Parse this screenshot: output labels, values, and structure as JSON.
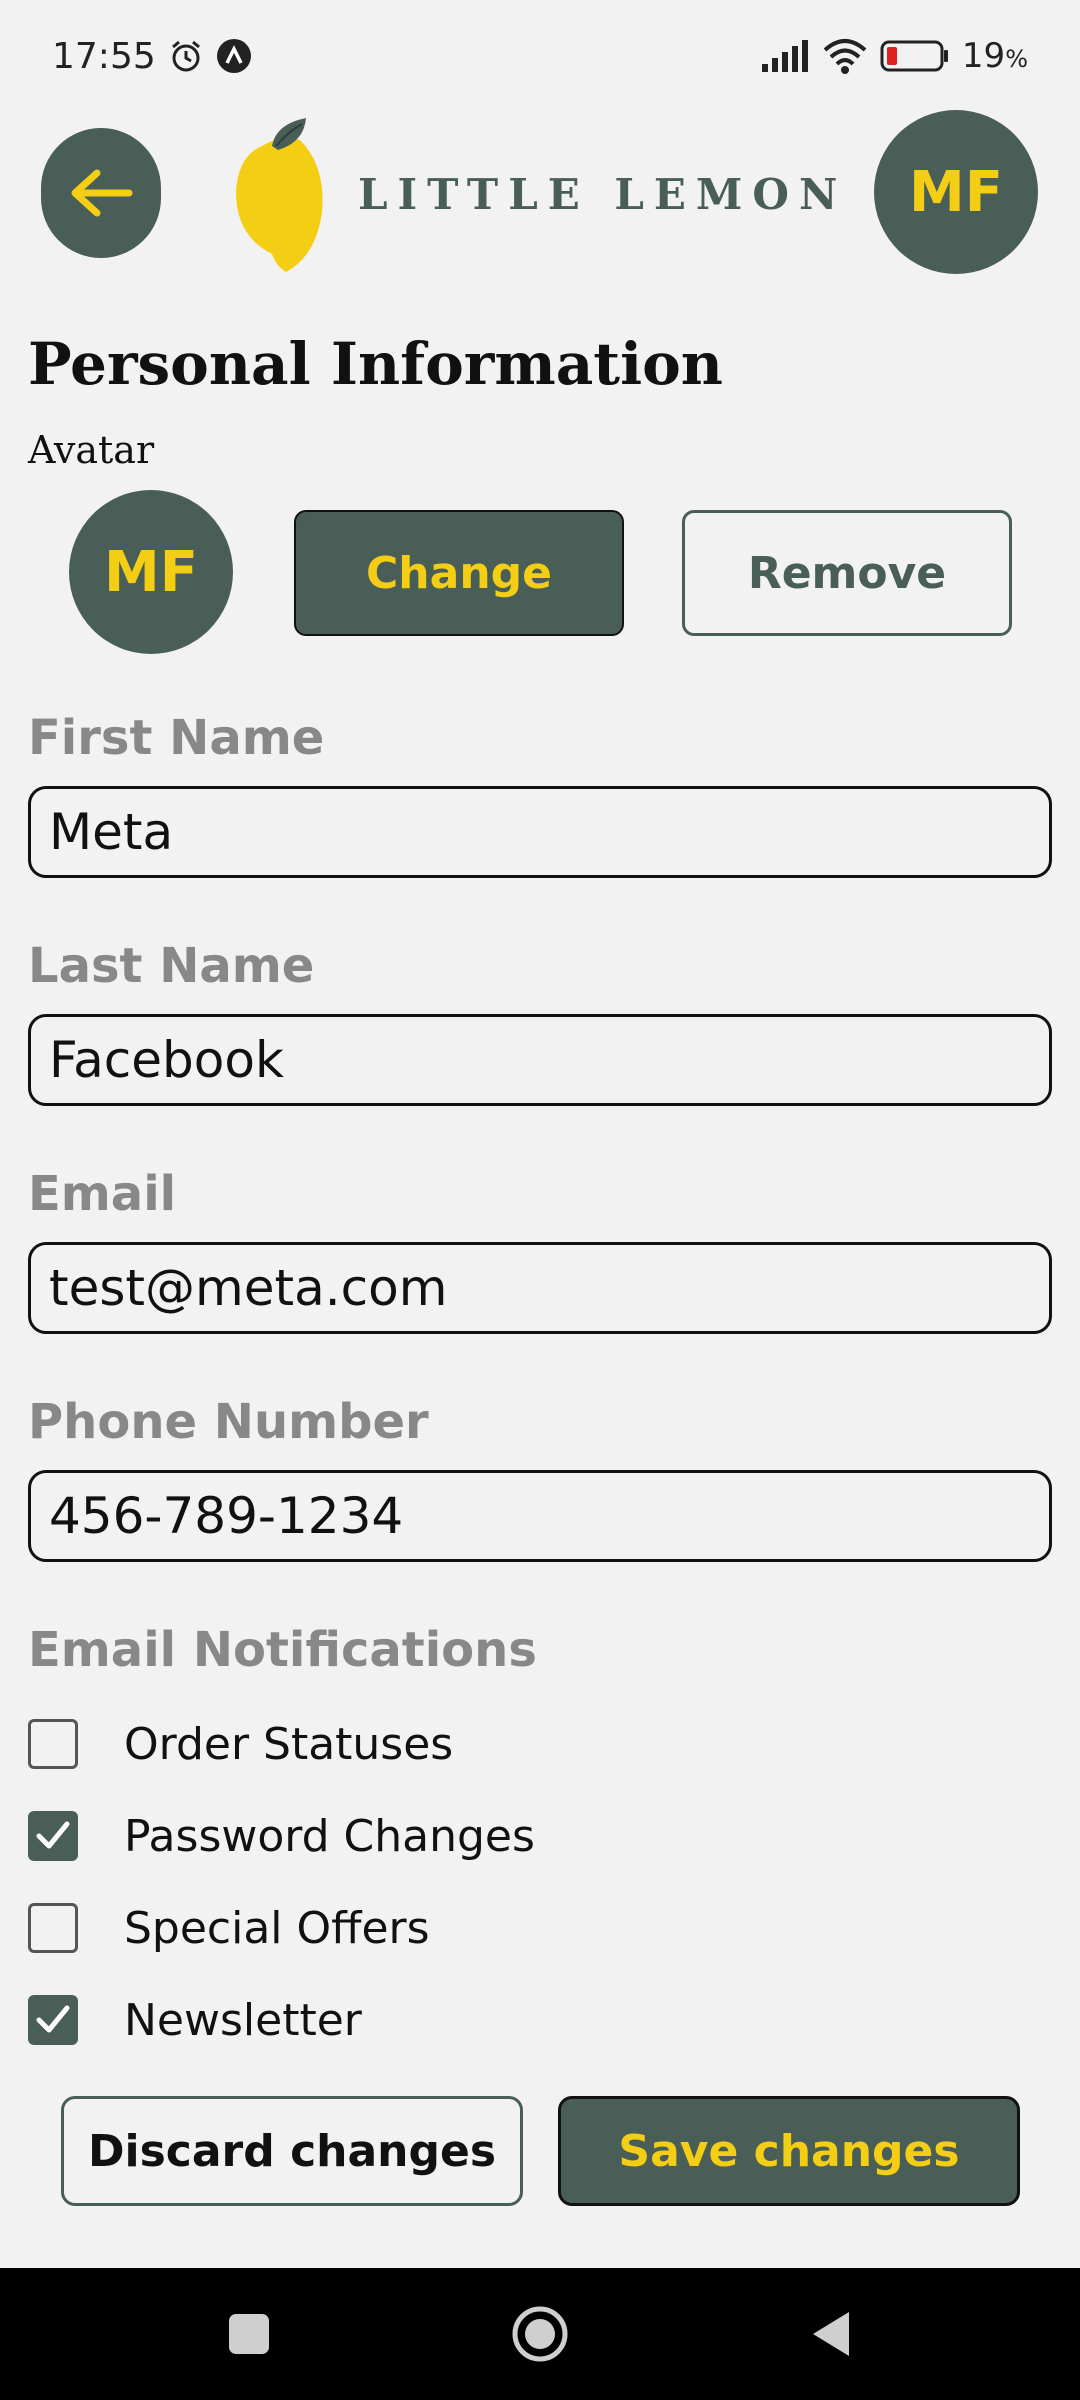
{
  "status_bar": {
    "time": "17:55",
    "battery_percent": "19",
    "battery_suffix": "%",
    "icons": [
      "alarm-icon",
      "app-notification-icon",
      "signal-icon",
      "wifi-icon",
      "battery-icon"
    ]
  },
  "header": {
    "back_icon": "arrow-left-icon",
    "logo_text": "LITTLE LEMON",
    "avatar_initials": "MF"
  },
  "colors": {
    "primary": "#495e57",
    "accent": "#f4ce14",
    "background": "#f2f2f2"
  },
  "page": {
    "title": "Personal Information",
    "avatar_label": "Avatar",
    "avatar_initials": "MF",
    "change_label": "Change",
    "remove_label": "Remove"
  },
  "form": {
    "first_name": {
      "label": "First Name",
      "value": "Meta"
    },
    "last_name": {
      "label": "Last Name",
      "value": "Facebook"
    },
    "email": {
      "label": "Email",
      "value": "test@meta.com"
    },
    "phone": {
      "label": "Phone Number",
      "value": "456-789-1234"
    }
  },
  "notifications": {
    "title": "Email Notifications",
    "items": [
      {
        "label": "Order Statuses",
        "checked": false
      },
      {
        "label": "Password Changes",
        "checked": true
      },
      {
        "label": "Special Offers",
        "checked": false
      },
      {
        "label": "Newsletter",
        "checked": true
      }
    ]
  },
  "actions": {
    "discard_label": "Discard changes",
    "save_label": "Save changes"
  },
  "nav": {
    "icons": [
      "recents-icon",
      "home-icon",
      "back-icon"
    ]
  }
}
